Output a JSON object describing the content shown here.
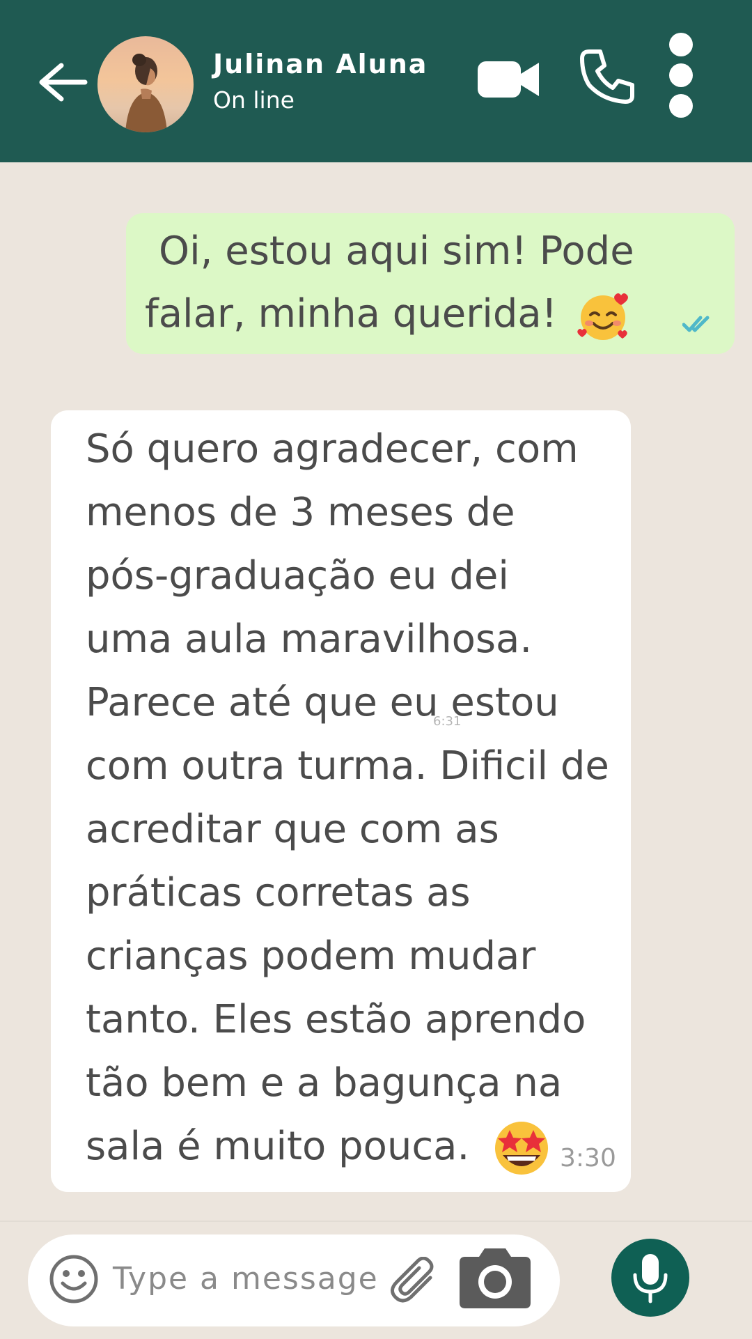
{
  "header": {
    "contact_name": "Julinan Aluna",
    "status": "On line",
    "back_icon": "arrow-left-icon",
    "video_icon": "video-camera-icon",
    "call_icon": "phone-icon",
    "menu_icon": "more-vertical-icon"
  },
  "messages": {
    "outgoing": {
      "lines": [
        "Oi, estou aqui sim! Pode",
        "falar, minha querida!"
      ],
      "emoji": "smiling-face-with-hearts",
      "status_icon": "double-check-read-icon"
    },
    "incoming": {
      "lines": [
        "Só quero agradecer, com",
        "menos de 3 meses de",
        "pós-graduação eu dei",
        "uma aula maravilhosa.",
        "Parece até que eu estou",
        "com outra turma. Dificil de",
        "acreditar que com as",
        "práticas corretas as",
        "crianças podem mudar",
        "tanto. Eles estão aprendo",
        "tão bem e a bagunça na",
        "sala é muito pouca."
      ],
      "emoji": "star-struck",
      "overlay_time": "6:31",
      "time": "3:30"
    }
  },
  "composer": {
    "placeholder": "Type a message",
    "emoji_icon": "smiley-icon",
    "attach_icon": "paperclip-icon",
    "camera_icon": "camera-icon",
    "mic_icon": "microphone-icon"
  },
  "colors": {
    "header_bg": "#1f5a52",
    "chat_bg": "#ece5dd",
    "outgoing_bubble": "#dcf8c6",
    "incoming_bubble": "#ffffff",
    "mic_button": "#0f6054",
    "read_ticks": "#4fb8c9"
  }
}
